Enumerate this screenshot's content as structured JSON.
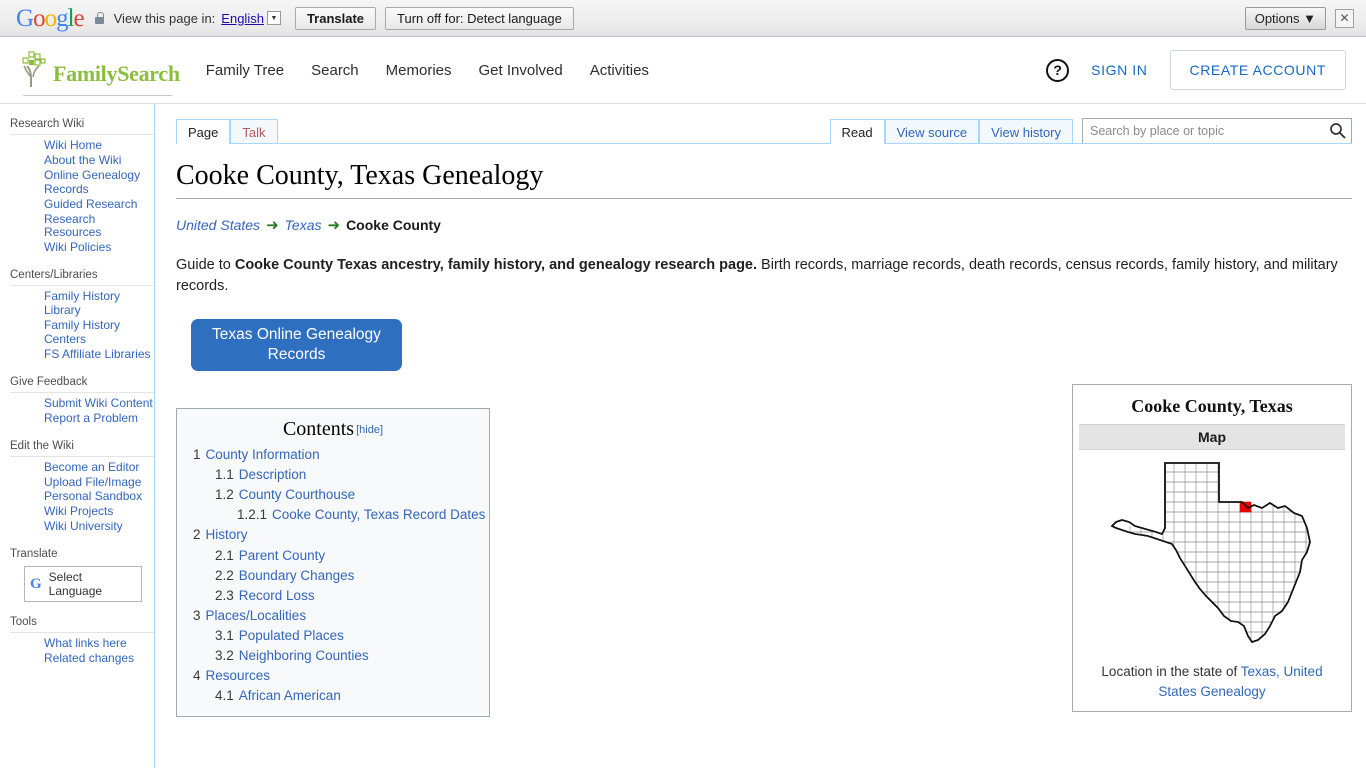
{
  "translate_bar": {
    "logo": "Google",
    "lock_icon": "lock-icon",
    "view_text": "View this page in:",
    "language": "English",
    "translate_button": "Translate",
    "turnoff_button": "Turn off for: Detect language",
    "options_button": "Options",
    "close_icon": "close-icon"
  },
  "header": {
    "brand": "FamilySearch",
    "nav": [
      {
        "label": "Family Tree"
      },
      {
        "label": "Search"
      },
      {
        "label": "Memories"
      },
      {
        "label": "Get Involved"
      },
      {
        "label": "Activities"
      }
    ],
    "help_icon": "question-mark-icon",
    "sign_in": "SIGN IN",
    "create_account": "CREATE ACCOUNT"
  },
  "sidebar": {
    "sections": [
      {
        "heading": "Research Wiki",
        "items": [
          "Wiki Home",
          "About the Wiki",
          "Online Genealogy Records",
          "Guided Research",
          "Research Resources",
          "Wiki Policies"
        ]
      },
      {
        "heading": "Centers/Libraries",
        "items": [
          "Family History Library",
          "Family History Centers",
          "FS Affiliate Libraries"
        ]
      },
      {
        "heading": "Give Feedback",
        "items": [
          "Submit Wiki Content",
          "Report a Problem"
        ]
      },
      {
        "heading": "Edit the Wiki",
        "items": [
          "Become an Editor",
          "Upload File/Image",
          "Personal Sandbox",
          "Wiki Projects",
          "Wiki University"
        ]
      }
    ],
    "translate_heading": "Translate",
    "select_language": "Select Language",
    "tools_heading": "Tools",
    "tools_items": [
      "What links here",
      "Related changes"
    ]
  },
  "tabs": {
    "left": [
      {
        "label": "Page",
        "active": true
      },
      {
        "label": "Talk",
        "active": false
      }
    ],
    "right": [
      {
        "label": "Read",
        "active": true
      },
      {
        "label": "View source",
        "active": false
      },
      {
        "label": "View history",
        "active": false
      }
    ]
  },
  "search": {
    "placeholder": "Search by place or topic",
    "value": "",
    "icon": "search-icon"
  },
  "main": {
    "title": "Cooke County, Texas Genealogy",
    "breadcrumb": {
      "first": "United States",
      "second": "Texas",
      "current": "Cooke County",
      "arrow": "➜"
    },
    "lede_prefix": "Guide to ",
    "lede_bold": "Cooke County Texas ancestry, family history, and genealogy research page.",
    "lede_suffix": " Birth records, marriage records, death records, census records, family history, and military records.",
    "records_button": "Texas Online Genealogy Records"
  },
  "toc": {
    "title": "Contents",
    "hide_label": "[hide]",
    "entries": [
      {
        "num": "1",
        "label": "County Information",
        "level": 1
      },
      {
        "num": "1.1",
        "label": "Description",
        "level": 2
      },
      {
        "num": "1.2",
        "label": "County Courthouse",
        "level": 2
      },
      {
        "num": "1.2.1",
        "label": "Cooke County, Texas Record Dates",
        "level": 3
      },
      {
        "num": "2",
        "label": "History",
        "level": 1
      },
      {
        "num": "2.1",
        "label": "Parent County",
        "level": 2
      },
      {
        "num": "2.2",
        "label": "Boundary Changes",
        "level": 2
      },
      {
        "num": "2.3",
        "label": "Record Loss",
        "level": 2
      },
      {
        "num": "3",
        "label": "Places/Localities",
        "level": 1
      },
      {
        "num": "3.1",
        "label": "Populated Places",
        "level": 2
      },
      {
        "num": "3.2",
        "label": "Neighboring Counties",
        "level": 2
      },
      {
        "num": "4",
        "label": "Resources",
        "level": 1
      },
      {
        "num": "4.1",
        "label": "African American",
        "level": 2
      }
    ]
  },
  "infobox": {
    "title": "Cooke County, Texas",
    "subheader": "Map",
    "map_icon": "texas-county-map",
    "caption_prefix": "Location in the state of ",
    "caption_link": "Texas, United States Genealogy"
  },
  "colors": {
    "link": "#3366bb",
    "brand_green": "#8bbe3c",
    "button_blue": "#2f6fc0",
    "highlight_red": "#ee0000",
    "tab_border": "#a7d7f9"
  }
}
